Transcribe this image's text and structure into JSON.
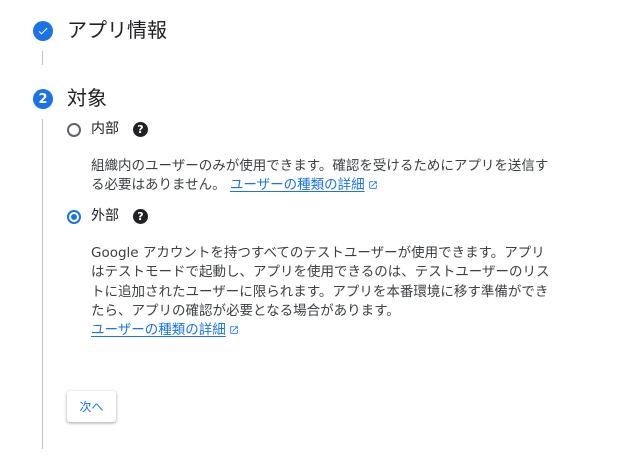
{
  "steps": [
    {
      "title": "アプリ情報",
      "status": "completed"
    },
    {
      "number": "2",
      "title": "対象",
      "status": "active"
    }
  ],
  "options": {
    "internal": {
      "label": "内部",
      "help": "?",
      "selected": false,
      "description": "組織内のユーザーのみが使用できます。確認を受けるためにアプリを送信する必要はありません。",
      "link": "ユーザーの種類の詳細"
    },
    "external": {
      "label": "外部",
      "help": "?",
      "selected": true,
      "description": "Google アカウントを持つすべてのテストユーザーが使用できます。アプリはテストモードで起動し、アプリを使用できるのは、テストユーザーのリストに追加されたユーザーに限られます。アプリを本番環境に移す準備ができたら、アプリの確認が必要となる場合があります。",
      "link": "ユーザーの種類の詳細"
    }
  },
  "actions": {
    "next_label": "次へ"
  },
  "colors": {
    "accent": "#1a73e8",
    "text": "#202124",
    "secondary_text": "#3c4043",
    "connector_line": "#bdc1c6"
  },
  "icons": {
    "completed_step": "check-icon",
    "help": "help-icon",
    "external_link": "open-in-new-icon"
  }
}
